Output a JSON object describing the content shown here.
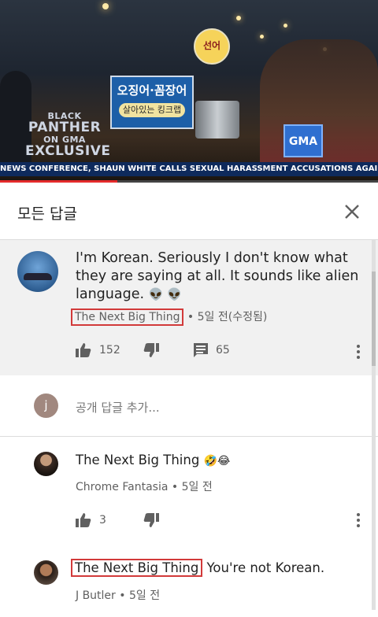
{
  "video": {
    "sign_text": "오징어·꼼장어",
    "sign_sub_text": "살아있는 킹크랩",
    "round_sign_text": "선어",
    "show_logo_line1": "BLACK",
    "show_logo_line2": "PANTHER",
    "show_logo_line3": "ON GMA",
    "show_logo_line4": "EXCLUSIVE",
    "channel_badge": "GMA",
    "ticker_text": "NEWS CONFERENCE, SHAUN WHITE CALLS SEXUAL HARASSMENT ACCUSATIONS AGAINST HIM \"GOS",
    "progress_fraction": 0.31
  },
  "header": {
    "title": "모든 답글",
    "close_icon": "close-icon"
  },
  "main_comment": {
    "text": "I'm Korean. Seriously I don't know what they are saying at all.  It sounds like alien language.",
    "emoji": "👽 👽",
    "author": "The Next Big Thing",
    "time": "• 5일 전(수정됨)",
    "likes": "152",
    "replies": "65"
  },
  "reply_input": {
    "avatar_letter": "j",
    "placeholder": "공개 답글 추가..."
  },
  "replies": [
    {
      "text": "The Next Big Thing",
      "emoji": "🤣😂",
      "author": "Chrome Fantasia",
      "time": "• 5일 전",
      "likes": "3"
    },
    {
      "mention": "The Next Big Thing",
      "text": " You're not Korean.",
      "author": "J Butler",
      "time": "• 5일 전"
    }
  ],
  "colors": {
    "highlight_box": "#d23a3a",
    "progress": "#e52b2b",
    "comment_bg": "#f1f1f1"
  }
}
